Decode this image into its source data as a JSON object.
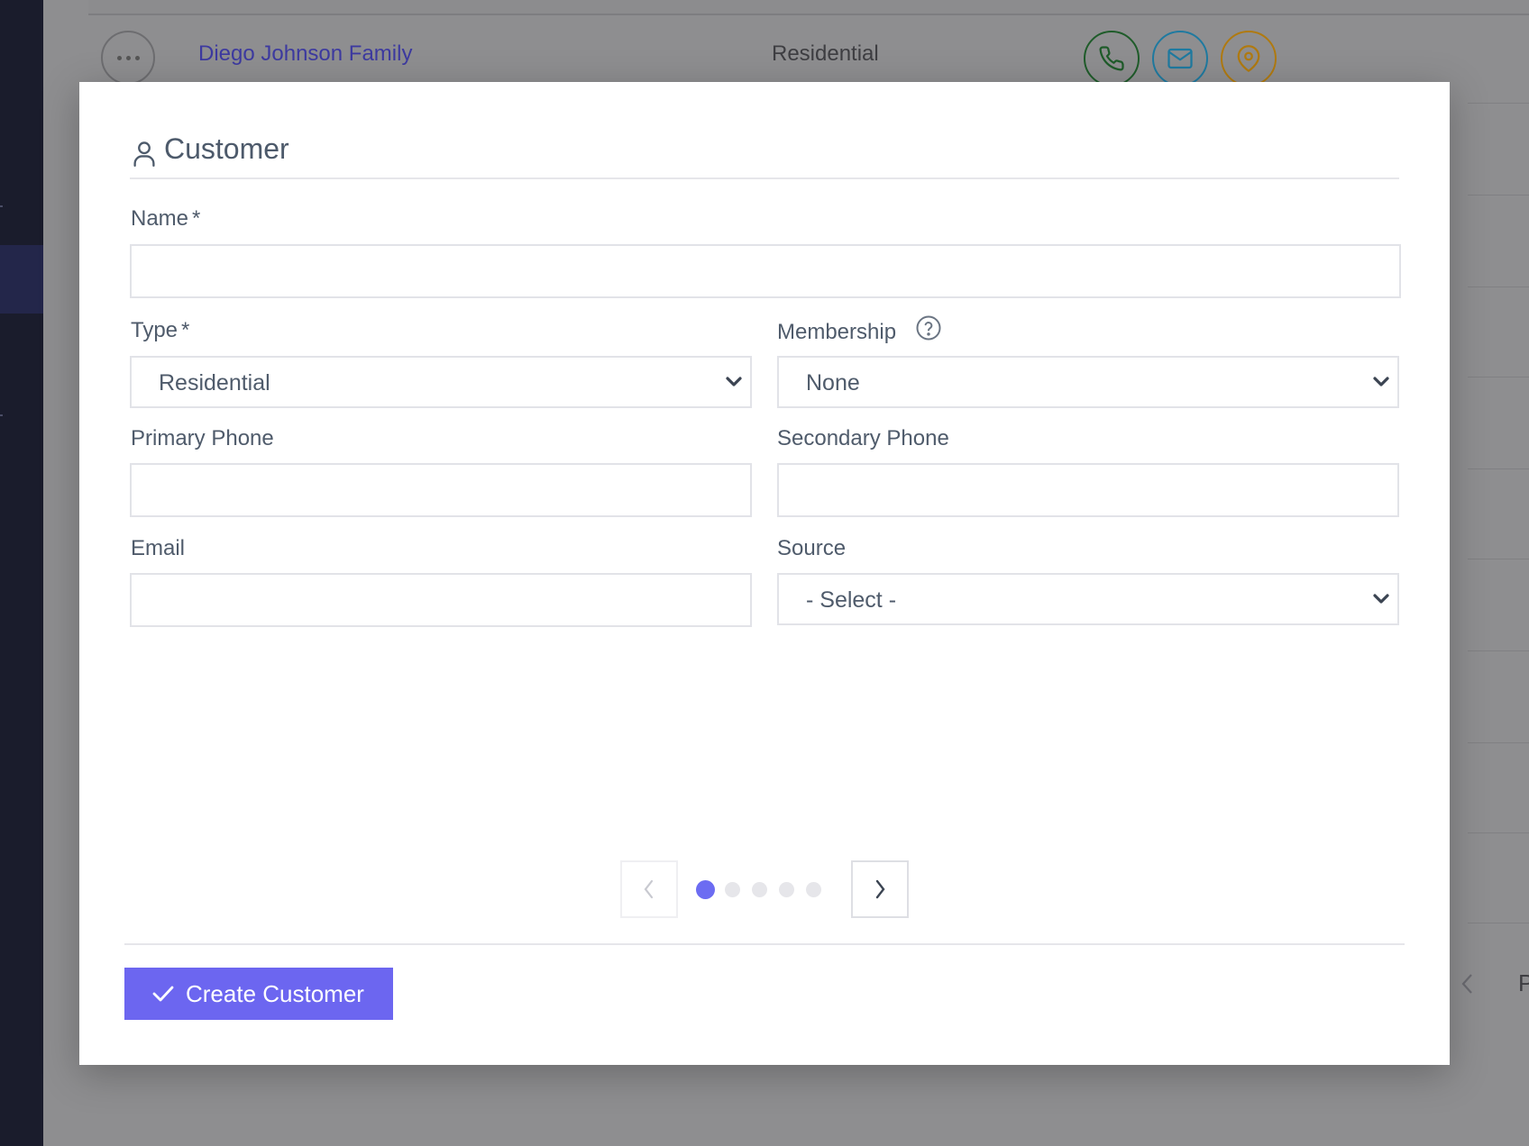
{
  "background": {
    "row": {
      "customer_name": "Diego Johnson Family",
      "customer_type": "Residential",
      "actions": [
        {
          "icon": "phone-icon",
          "color": "#1f5c2a"
        },
        {
          "icon": "mail-icon",
          "color": "#1f7aa0"
        },
        {
          "icon": "map-pin-icon",
          "color": "#b07a10"
        }
      ]
    },
    "pager_partial_text": "P"
  },
  "modal": {
    "title": "Customer",
    "title_icon": "user-icon",
    "fields": {
      "name": {
        "label": "Name",
        "required_mark": "*",
        "value": "",
        "placeholder": ""
      },
      "type": {
        "label": "Type",
        "required_mark": "*",
        "selected": "Residential"
      },
      "membership": {
        "label": "Membership",
        "selected": "None",
        "help_icon": "question-circle-icon"
      },
      "primary_phone": {
        "label": "Primary Phone",
        "value": "",
        "placeholder": ""
      },
      "secondary_phone": {
        "label": "Secondary Phone",
        "value": "",
        "placeholder": ""
      },
      "email": {
        "label": "Email",
        "value": "",
        "placeholder": ""
      },
      "source": {
        "label": "Source",
        "selected": "- Select -"
      }
    },
    "pager": {
      "current_step": 1,
      "total_steps": 5,
      "accent": "#6c6cf2"
    },
    "submit": {
      "label": "Create Customer",
      "icon": "check-icon",
      "color": "#6c66f0"
    }
  }
}
